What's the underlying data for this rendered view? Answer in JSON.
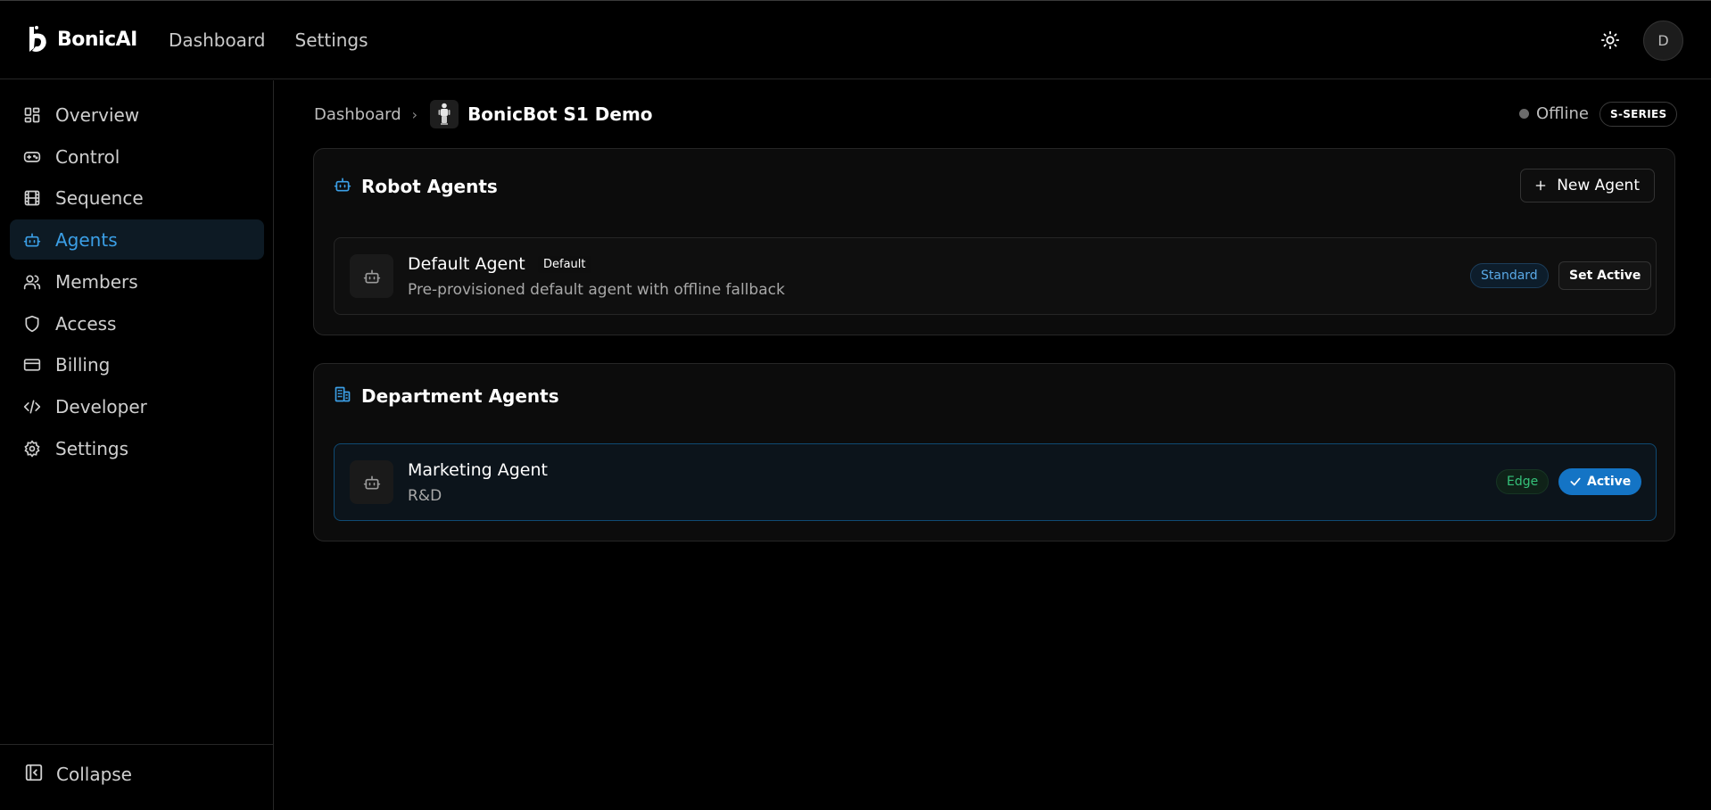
{
  "app": {
    "brand": "BonicAI"
  },
  "topnav": {
    "items": [
      {
        "label": "Dashboard"
      },
      {
        "label": "Settings"
      }
    ],
    "avatar_initial": "D"
  },
  "sidebar": {
    "items": [
      {
        "label": "Overview",
        "icon": "grid-icon"
      },
      {
        "label": "Control",
        "icon": "gamepad-icon"
      },
      {
        "label": "Sequence",
        "icon": "film-icon"
      },
      {
        "label": "Agents",
        "icon": "robot-icon",
        "active": true
      },
      {
        "label": "Members",
        "icon": "users-icon"
      },
      {
        "label": "Access",
        "icon": "shield-icon"
      },
      {
        "label": "Billing",
        "icon": "credit-card-icon"
      },
      {
        "label": "Developer",
        "icon": "code-icon"
      },
      {
        "label": "Settings",
        "icon": "gear-icon"
      }
    ],
    "collapse_label": "Collapse"
  },
  "breadcrumb": {
    "root": "Dashboard",
    "current": "BonicBot S1 Demo"
  },
  "device": {
    "status": "Offline",
    "series": "S-SERIES"
  },
  "robot_agents": {
    "title": "Robot Agents",
    "new_button": "New Agent",
    "agents": [
      {
        "name": "Default Agent",
        "tag": "Default",
        "description": "Pre-provisioned default agent with offline fallback",
        "tier": "Standard",
        "action": "Set Active"
      }
    ]
  },
  "department_agents": {
    "title": "Department Agents",
    "agents": [
      {
        "name": "Marketing Agent",
        "description": "R&D",
        "tier": "Edge",
        "action": "Active"
      }
    ]
  },
  "colors": {
    "accent": "#1474c5",
    "accent_text": "#3b9fe6",
    "edge_green": "#35c27a",
    "background": "#000000"
  }
}
